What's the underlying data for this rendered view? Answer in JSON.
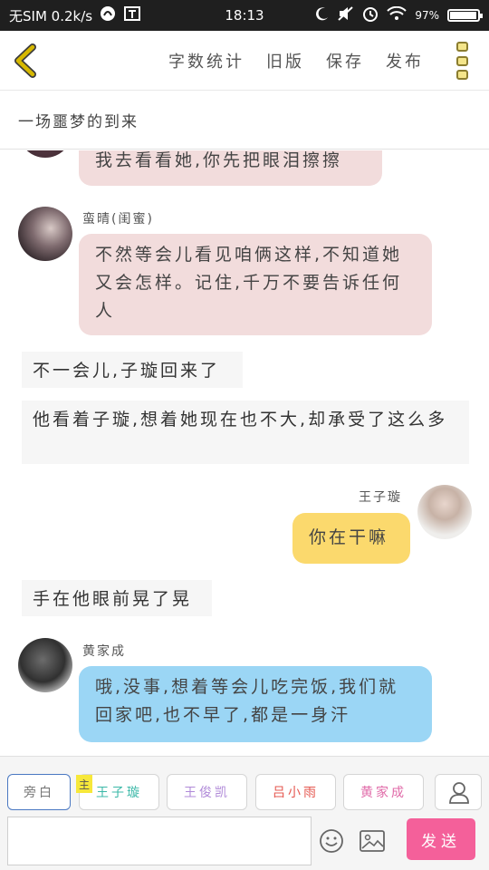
{
  "status_bar": {
    "left_text": "无SIM 0.2k/s",
    "time": "18:13",
    "battery": "97%",
    "battery_level": 0.97
  },
  "nav": {
    "actions": [
      "字数统计",
      "旧版",
      "保存",
      "发布"
    ]
  },
  "story": {
    "title": "一场噩梦的到来"
  },
  "messages": [
    {
      "kind": "bubble",
      "side": "left",
      "color": "pink",
      "text": "我去看看她,你先把眼泪擦擦"
    },
    {
      "kind": "bubble",
      "side": "left",
      "color": "pink",
      "name": "蛮晴(闺蜜)",
      "text": "不然等会儿看见咱俩这样,不知道她又会怎样。记住,千万不要告诉任何人"
    },
    {
      "kind": "narration",
      "text": "不一会儿,子璇回来了"
    },
    {
      "kind": "narration",
      "text": "他看着子璇,想着她现在也不大,却承受了这么多"
    },
    {
      "kind": "bubble",
      "side": "right",
      "color": "yellow",
      "name": "王子璇",
      "text": "你在干嘛"
    },
    {
      "kind": "narration",
      "text": "手在他眼前晃了晃"
    },
    {
      "kind": "bubble",
      "side": "left",
      "color": "blue",
      "name": "黄家成",
      "text": "哦,没事,想着等会儿吃完饭,我们就回家吧,也不早了,都是一身汗"
    }
  ],
  "characters": {
    "main_badge": "主",
    "tabs": [
      {
        "label": "旁白",
        "color": "#777777"
      },
      {
        "label": "王子璇",
        "color": "#3bb8a8"
      },
      {
        "label": "王俊凯",
        "color": "#b08ad8"
      },
      {
        "label": "吕小雨",
        "color": "#e5574f"
      },
      {
        "label": "黄家成",
        "color": "#e06aa8"
      }
    ]
  },
  "composer": {
    "placeholder": "",
    "send_label": "发送"
  },
  "colors": {
    "bubble_pink": "#f2dcdc",
    "bubble_yellow": "#fbd96d",
    "bubble_blue": "#9bd6f5",
    "send_button": "#f4609a",
    "back_arrow": "#c9a600"
  }
}
